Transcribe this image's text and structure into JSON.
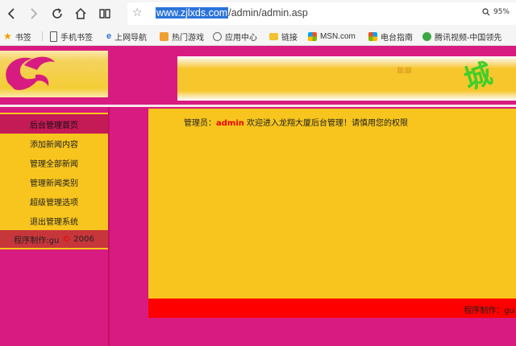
{
  "browser": {
    "url_selected": "www.zjlxds.com",
    "url_rest": "/admin/admin.asp",
    "zoom": "95%",
    "bookmarks": [
      {
        "label": "书签",
        "icon": "star-icon",
        "color": "#f2a100"
      },
      {
        "label": "手机书签",
        "icon": "phone-icon",
        "color": "#555555"
      },
      {
        "label": "上网导航",
        "icon": "ie-icon",
        "color": "#2b74d8"
      },
      {
        "label": "热门游戏",
        "icon": "game-icon",
        "color": "#f0a030"
      },
      {
        "label": "应用中心",
        "icon": "globe-icon",
        "color": "#666666"
      },
      {
        "label": "链接",
        "icon": "folder-icon",
        "color": "#f2c230"
      },
      {
        "label": "MSN.com",
        "icon": "msn-icon",
        "color": "#1e88e5"
      },
      {
        "label": "电台指南",
        "icon": "windows-icon",
        "color": "#e53935"
      },
      {
        "label": "腾讯视频-中国领先",
        "icon": "tencent-video-icon",
        "color": "#3ba745"
      }
    ]
  },
  "sidebar": {
    "items": [
      {
        "label": "后台管理首页",
        "active": true
      },
      {
        "label": "添加新闻内容"
      },
      {
        "label": "管理全部新闻"
      },
      {
        "label": "管理新闻类别"
      },
      {
        "label": "超级管理选项"
      },
      {
        "label": "退出管理系统"
      }
    ],
    "footer": {
      "prefix": "程序制作:gu",
      "symbol": "©",
      "year": "2006"
    }
  },
  "main": {
    "welcome_prefix": "管理员：",
    "admin_name": "admin",
    "welcome_suffix": " 欢迎进入龙翔大厦后台管理！请慎用您的权限"
  },
  "footer": {
    "text": "程序制作：gu"
  },
  "banner": {
    "char": "城"
  },
  "colors": {
    "page_bg": "#d81b80",
    "panel": "#f7c51d",
    "footer_bar": "#ff0000",
    "active_item": "#c41a55"
  }
}
